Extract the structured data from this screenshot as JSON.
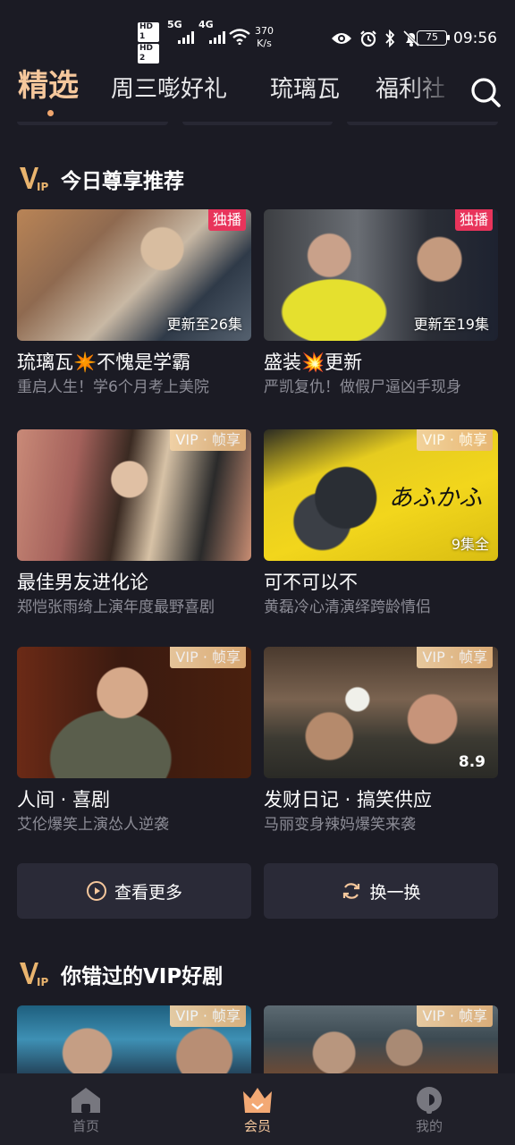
{
  "status_bar": {
    "hd1": "HD 1",
    "hd2": "HD 2",
    "sig1": "5G",
    "sig2": "4G",
    "net_speed_value": "370",
    "net_speed_unit": "K/s",
    "battery": "75",
    "time": "09:56"
  },
  "top_tabs": {
    "items": [
      "精选",
      "周三嘭好礼",
      "琉璃瓦",
      "福利社"
    ],
    "active_index": 0
  },
  "section1": {
    "title": "今日尊享推荐",
    "cards": [
      {
        "title": "琉璃瓦✴️不愧是学霸",
        "subtitle": "重启人生！学6个月考上美院",
        "badge": "独播",
        "overlay": "更新至26集"
      },
      {
        "title": "盛装💥更新",
        "subtitle": "严凯复仇！做假尸逼凶手现身",
        "badge": "独播",
        "overlay": "更新至19集"
      },
      {
        "title": "最佳男友进化论",
        "subtitle": "郑恺张雨绮上演年度最野喜剧",
        "badge": "VIP · 帧享",
        "overlay": ""
      },
      {
        "title": "可不可以不",
        "subtitle": "黄磊冷心清演绎跨龄情侣",
        "badge": "VIP · 帧享",
        "overlay": "9集全"
      },
      {
        "title": "人间 · 喜剧",
        "subtitle": "艾伦爆笑上演怂人逆袭",
        "badge": "VIP · 帧享",
        "overlay": ""
      },
      {
        "title": "发财日记 · 搞笑供应",
        "subtitle": "马丽变身辣妈爆笑来袭",
        "badge": "VIP · 帧享",
        "overlay": "8.9"
      }
    ],
    "more_button": "查看更多",
    "refresh_button": "换一换"
  },
  "section2": {
    "title": "你错过的VIP好剧",
    "cards": [
      {
        "badge": "VIP · 帧享"
      },
      {
        "badge": "VIP · 帧享"
      }
    ]
  },
  "bottom_nav": {
    "items": [
      {
        "label": "首页",
        "icon": "home-icon"
      },
      {
        "label": "会员",
        "icon": "crown-icon"
      },
      {
        "label": "我的",
        "icon": "profile-icon"
      }
    ],
    "active_index": 1
  },
  "colors": {
    "background": "#1b1b24",
    "accent_gold": "#f5c79c",
    "badge_red": "#e8345b",
    "button_bg": "#2a2a37"
  }
}
